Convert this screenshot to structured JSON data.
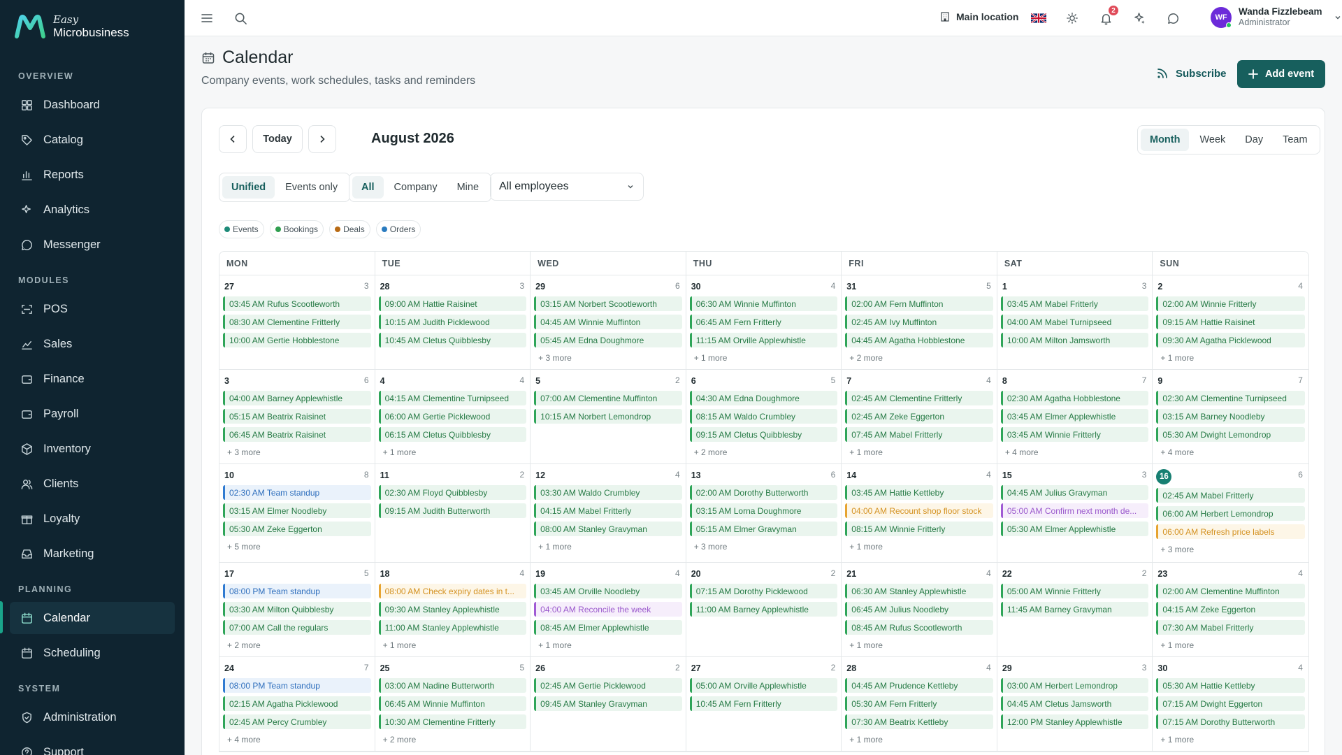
{
  "brand": {
    "line1": "Easy",
    "line2": "Microbusiness"
  },
  "sidebar": {
    "sections": [
      {
        "label": "OVERVIEW",
        "items": [
          {
            "label": "Dashboard",
            "icon": "grid-icon"
          },
          {
            "label": "Catalog",
            "icon": "tag-icon"
          },
          {
            "label": "Reports",
            "icon": "bar-chart-icon"
          },
          {
            "label": "Analytics",
            "icon": "sparkle-icon"
          },
          {
            "label": "Messenger",
            "icon": "chat-icon"
          }
        ]
      },
      {
        "label": "MODULES",
        "items": [
          {
            "label": "POS",
            "icon": "scan-icon"
          },
          {
            "label": "Sales",
            "icon": "line-chart-icon"
          },
          {
            "label": "Finance",
            "icon": "wallet-icon"
          },
          {
            "label": "Payroll",
            "icon": "wallet-icon"
          },
          {
            "label": "Inventory",
            "icon": "box-icon"
          },
          {
            "label": "Clients",
            "icon": "users-icon"
          },
          {
            "label": "Loyalty",
            "icon": "gift-icon"
          },
          {
            "label": "Marketing",
            "icon": "inbox-icon"
          }
        ]
      },
      {
        "label": "PLANNING",
        "items": [
          {
            "label": "Calendar",
            "icon": "calendar-icon",
            "active": true
          },
          {
            "label": "Scheduling",
            "icon": "calendar-icon"
          }
        ]
      },
      {
        "label": "SYSTEM",
        "items": [
          {
            "label": "Administration",
            "icon": "shield-icon"
          },
          {
            "label": "Support",
            "icon": "help-icon"
          }
        ]
      }
    ]
  },
  "topbar": {
    "location": "Main location",
    "notifications_count": "2",
    "user": {
      "initials": "WF",
      "name": "Wanda Fizzlebeam",
      "role": "Administrator"
    }
  },
  "header": {
    "title": "Calendar",
    "subtitle": "Company events, work schedules, tasks and reminders",
    "subscribe_label": "Subscribe",
    "add_event_label": "Add event"
  },
  "toolbar": {
    "today_label": "Today",
    "month_label": "August 2026",
    "views": [
      "Month",
      "Week",
      "Day",
      "Team"
    ],
    "active_view": "Month",
    "modes": [
      "Unified",
      "Events only"
    ],
    "active_mode": "Unified",
    "scopes": [
      "All",
      "Company",
      "Mine"
    ],
    "active_scope": "All",
    "employee_filter": "All employees"
  },
  "legend": [
    {
      "label": "Events",
      "color": "#1d8a78"
    },
    {
      "label": "Bookings",
      "color": "#2f9e4f"
    },
    {
      "label": "Deals",
      "color": "#b86a14"
    },
    {
      "label": "Orders",
      "color": "#2a7bbf"
    }
  ],
  "calendar": {
    "weekdays": [
      "MON",
      "TUE",
      "WED",
      "THU",
      "FRI",
      "SAT",
      "SUN"
    ],
    "weeks": [
      [
        {
          "day": "27",
          "count": "3",
          "events": [
            [
              "03:45 AM Rufus Scootleworth",
              "b"
            ],
            [
              "08:30 AM Clementine Fritterly",
              "b"
            ],
            [
              "10:00 AM Gertie Hobblestone",
              "b"
            ]
          ],
          "more": ""
        },
        {
          "day": "28",
          "count": "3",
          "events": [
            [
              "09:00 AM Hattie Raisinet",
              "b"
            ],
            [
              "10:15 AM Judith Picklewood",
              "b"
            ],
            [
              "10:45 AM Cletus Quibblesby",
              "b"
            ]
          ],
          "more": ""
        },
        {
          "day": "29",
          "count": "6",
          "events": [
            [
              "03:15 AM Norbert Scootleworth",
              "b"
            ],
            [
              "04:45 AM Winnie Muffinton",
              "b"
            ],
            [
              "05:45 AM Edna Doughmore",
              "b"
            ]
          ],
          "more": "+ 3 more"
        },
        {
          "day": "30",
          "count": "4",
          "events": [
            [
              "06:30 AM Winnie Muffinton",
              "b"
            ],
            [
              "06:45 AM Fern Fritterly",
              "b"
            ],
            [
              "11:15 AM Orville Applewhistle",
              "b"
            ]
          ],
          "more": "+ 1 more"
        },
        {
          "day": "31",
          "count": "5",
          "events": [
            [
              "02:00 AM Fern Muffinton",
              "b"
            ],
            [
              "02:45 AM Ivy Muffinton",
              "b"
            ],
            [
              "04:45 AM Agatha Hobblestone",
              "b"
            ]
          ],
          "more": "+ 2 more"
        },
        {
          "day": "1",
          "count": "3",
          "events": [
            [
              "03:45 AM Mabel Fritterly",
              "b"
            ],
            [
              "04:00 AM Mabel Turnipseed",
              "b"
            ],
            [
              "10:00 AM Milton Jamsworth",
              "b"
            ]
          ],
          "more": ""
        },
        {
          "day": "2",
          "count": "4",
          "events": [
            [
              "02:00 AM Winnie Fritterly",
              "b"
            ],
            [
              "09:15 AM Hattie Raisinet",
              "b"
            ],
            [
              "09:30 AM Agatha Picklewood",
              "b"
            ]
          ],
          "more": "+ 1 more"
        }
      ],
      [
        {
          "day": "3",
          "count": "6",
          "events": [
            [
              "04:00 AM Barney Applewhistle",
              "b"
            ],
            [
              "05:15 AM Beatrix Raisinet",
              "b"
            ],
            [
              "06:45 AM Beatrix Raisinet",
              "b"
            ]
          ],
          "more": "+ 3 more"
        },
        {
          "day": "4",
          "count": "4",
          "events": [
            [
              "04:15 AM Clementine Turnipseed",
              "b"
            ],
            [
              "06:00 AM Gertie Picklewood",
              "b"
            ],
            [
              "06:15 AM Cletus Quibblesby",
              "b"
            ]
          ],
          "more": "+ 1 more"
        },
        {
          "day": "5",
          "count": "2",
          "events": [
            [
              "07:00 AM Clementine Muffinton",
              "b"
            ],
            [
              "10:15 AM Norbert Lemondrop",
              "b"
            ]
          ],
          "more": ""
        },
        {
          "day": "6",
          "count": "5",
          "events": [
            [
              "04:30 AM Edna Doughmore",
              "b"
            ],
            [
              "08:15 AM Waldo Crumbley",
              "b"
            ],
            [
              "09:15 AM Cletus Quibblesby",
              "b"
            ]
          ],
          "more": "+ 2 more"
        },
        {
          "day": "7",
          "count": "4",
          "events": [
            [
              "02:45 AM Clementine Fritterly",
              "b"
            ],
            [
              "02:45 AM Zeke Eggerton",
              "b"
            ],
            [
              "07:45 AM Mabel Fritterly",
              "b"
            ]
          ],
          "more": "+ 1 more"
        },
        {
          "day": "8",
          "count": "7",
          "events": [
            [
              "02:30 AM Agatha Hobblestone",
              "b"
            ],
            [
              "03:45 AM Elmer Applewhistle",
              "b"
            ],
            [
              "03:45 AM Winnie Fritterly",
              "b"
            ]
          ],
          "more": "+ 4 more"
        },
        {
          "day": "9",
          "count": "7",
          "events": [
            [
              "02:30 AM Clementine Turnipseed",
              "b"
            ],
            [
              "03:15 AM Barney Noodleby",
              "b"
            ],
            [
              "05:30 AM Dwight Lemondrop",
              "b"
            ]
          ],
          "more": "+ 4 more"
        }
      ],
      [
        {
          "day": "10",
          "count": "8",
          "events": [
            [
              "02:30 AM Team standup",
              "t"
            ],
            [
              "03:15 AM Elmer Noodleby",
              "b"
            ],
            [
              "05:30 AM Zeke Eggerton",
              "b"
            ]
          ],
          "more": "+ 5 more"
        },
        {
          "day": "11",
          "count": "2",
          "events": [
            [
              "02:30 AM Floyd Quibblesby",
              "b"
            ],
            [
              "09:15 AM Judith Butterworth",
              "b"
            ]
          ],
          "more": ""
        },
        {
          "day": "12",
          "count": "4",
          "events": [
            [
              "03:30 AM Waldo Crumbley",
              "b"
            ],
            [
              "04:15 AM Mabel Fritterly",
              "b"
            ],
            [
              "08:00 AM Stanley Gravyman",
              "b"
            ]
          ],
          "more": "+ 1 more"
        },
        {
          "day": "13",
          "count": "6",
          "events": [
            [
              "02:00 AM Dorothy Butterworth",
              "b"
            ],
            [
              "03:15 AM Lorna Doughmore",
              "b"
            ],
            [
              "05:15 AM Elmer Gravyman",
              "b"
            ]
          ],
          "more": "+ 3 more"
        },
        {
          "day": "14",
          "count": "4",
          "events": [
            [
              "03:45 AM Hattie Kettleby",
              "b"
            ],
            [
              "04:00 AM Recount shop floor stock",
              "k"
            ],
            [
              "08:15 AM Winnie Fritterly",
              "b"
            ]
          ],
          "more": "+ 1 more"
        },
        {
          "day": "15",
          "count": "3",
          "events": [
            [
              "04:45 AM Julius Gravyman",
              "b"
            ],
            [
              "05:00 AM Confirm next month de...",
              "r"
            ],
            [
              "05:30 AM Elmer Applewhistle",
              "b"
            ]
          ],
          "more": ""
        },
        {
          "day": "16",
          "count": "6",
          "today": true,
          "events": [
            [
              "02:45 AM Mabel Fritterly",
              "b"
            ],
            [
              "06:00 AM Herbert Lemondrop",
              "b"
            ],
            [
              "06:00 AM Refresh price labels",
              "k"
            ]
          ],
          "more": "+ 3 more"
        }
      ],
      [
        {
          "day": "17",
          "count": "5",
          "events": [
            [
              "08:00 PM Team standup",
              "t"
            ],
            [
              "03:30 AM Milton Quibblesby",
              "b"
            ],
            [
              "07:00 AM Call the regulars",
              "b"
            ]
          ],
          "more": "+ 2 more"
        },
        {
          "day": "18",
          "count": "4",
          "events": [
            [
              "08:00 AM Check expiry dates in t...",
              "k"
            ],
            [
              "09:30 AM Stanley Applewhistle",
              "b"
            ],
            [
              "11:00 AM Stanley Applewhistle",
              "b"
            ]
          ],
          "more": "+ 1 more"
        },
        {
          "day": "19",
          "count": "4",
          "events": [
            [
              "03:45 AM Orville Noodleby",
              "b"
            ],
            [
              "04:00 AM Reconcile the week",
              "r"
            ],
            [
              "08:45 AM Elmer Applewhistle",
              "b"
            ]
          ],
          "more": "+ 1 more"
        },
        {
          "day": "20",
          "count": "2",
          "events": [
            [
              "07:15 AM Dorothy Picklewood",
              "b"
            ],
            [
              "11:00 AM Barney Applewhistle",
              "b"
            ]
          ],
          "more": ""
        },
        {
          "day": "21",
          "count": "4",
          "events": [
            [
              "06:30 AM Stanley Applewhistle",
              "b"
            ],
            [
              "06:45 AM Julius Noodleby",
              "b"
            ],
            [
              "08:45 AM Rufus Scootleworth",
              "b"
            ]
          ],
          "more": "+ 1 more"
        },
        {
          "day": "22",
          "count": "2",
          "events": [
            [
              "05:00 AM Winnie Fritterly",
              "b"
            ],
            [
              "11:45 AM Barney Gravyman",
              "b"
            ]
          ],
          "more": ""
        },
        {
          "day": "23",
          "count": "4",
          "events": [
            [
              "02:00 AM Clementine Muffinton",
              "b"
            ],
            [
              "04:15 AM Zeke Eggerton",
              "b"
            ],
            [
              "07:30 AM Mabel Fritterly",
              "b"
            ]
          ],
          "more": "+ 1 more"
        }
      ],
      [
        {
          "day": "24",
          "count": "7",
          "events": [
            [
              "08:00 PM Team standup",
              "t"
            ],
            [
              "02:15 AM Agatha Picklewood",
              "b"
            ],
            [
              "02:45 AM Percy Crumbley",
              "b"
            ]
          ],
          "more": "+ 4 more"
        },
        {
          "day": "25",
          "count": "5",
          "events": [
            [
              "03:00 AM Nadine Butterworth",
              "b"
            ],
            [
              "06:45 AM Winnie Muffinton",
              "b"
            ],
            [
              "10:30 AM Clementine Fritterly",
              "b"
            ]
          ],
          "more": "+ 2 more"
        },
        {
          "day": "26",
          "count": "2",
          "events": [
            [
              "02:45 AM Gertie Picklewood",
              "b"
            ],
            [
              "09:45 AM Stanley Gravyman",
              "b"
            ]
          ],
          "more": ""
        },
        {
          "day": "27",
          "count": "2",
          "events": [
            [
              "05:00 AM Orville Applewhistle",
              "b"
            ],
            [
              "10:45 AM Fern Fritterly",
              "b"
            ]
          ],
          "more": ""
        },
        {
          "day": "28",
          "count": "4",
          "events": [
            [
              "04:45 AM Prudence Kettleby",
              "b"
            ],
            [
              "05:30 AM Fern Fritterly",
              "b"
            ],
            [
              "07:30 AM Beatrix Kettleby",
              "b"
            ]
          ],
          "more": "+ 1 more"
        },
        {
          "day": "29",
          "count": "3",
          "events": [
            [
              "03:00 AM Herbert Lemondrop",
              "b"
            ],
            [
              "04:45 AM Cletus Jamsworth",
              "b"
            ],
            [
              "12:00 PM Stanley Applewhistle",
              "b"
            ]
          ],
          "more": ""
        },
        {
          "day": "30",
          "count": "4",
          "events": [
            [
              "05:30 AM Hattie Kettleby",
              "b"
            ],
            [
              "07:15 AM Dwight Eggerton",
              "b"
            ],
            [
              "07:15 AM Dorothy Butterworth",
              "b"
            ]
          ],
          "more": "+ 1 more"
        }
      ]
    ]
  }
}
